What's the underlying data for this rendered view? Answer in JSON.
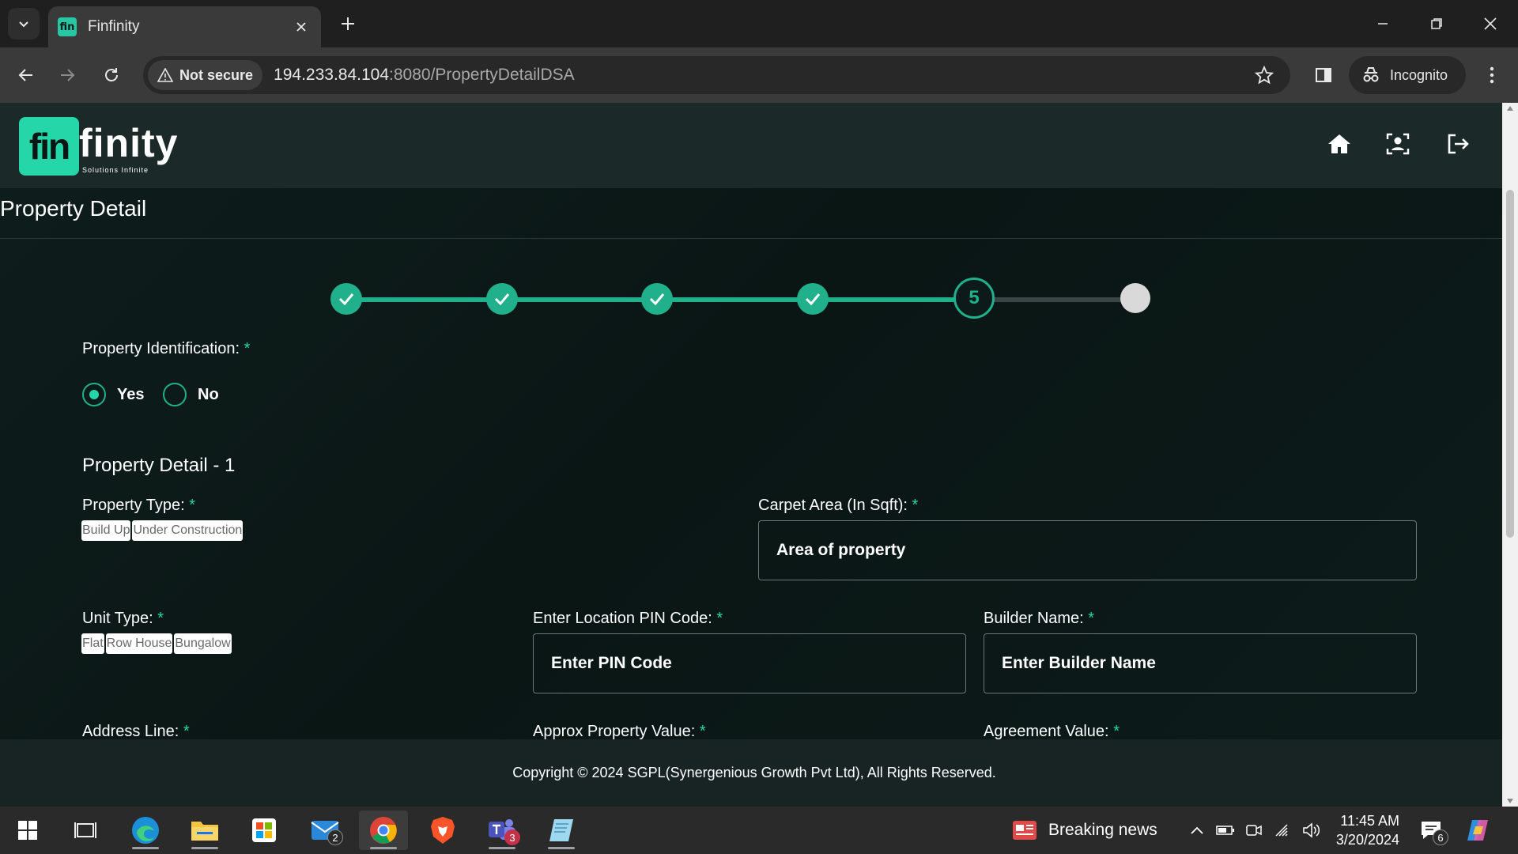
{
  "browser": {
    "tab_title": "Finfinity",
    "tab_favicon_text": "fin",
    "security_label": "Not secure",
    "url_host": "194.233.84.104",
    "url_path": ":8080/PropertyDetailDSA",
    "profile_label": "Incognito"
  },
  "header": {
    "logo_mark": "fin",
    "logo_text": "finity",
    "logo_tagline": "Solutions Infinite",
    "icons": [
      "home-icon",
      "profile-icon",
      "logout-icon"
    ]
  },
  "page": {
    "title": "Property Detail"
  },
  "stepper": {
    "total_steps": 6,
    "completed_steps": 4,
    "active_step_label": "5",
    "colors": {
      "done": "#21b08c",
      "pending": "#d9d9d9",
      "track": "#3a4645"
    }
  },
  "form": {
    "property_identification": {
      "label": "Property Identification:",
      "required_mark": "*",
      "options": [
        {
          "label": "Yes",
          "selected": true
        },
        {
          "label": "No",
          "selected": false
        }
      ]
    },
    "section_title": "Property Detail - 1",
    "property_type": {
      "label": "Property Type:",
      "required_mark": "*",
      "options": [
        "Build Up",
        "Under Construction"
      ]
    },
    "carpet_area": {
      "label": "Carpet Area (In Sqft):",
      "required_mark": "*",
      "placeholder": "Area of property"
    },
    "unit_type": {
      "label": "Unit Type:",
      "required_mark": "*",
      "options": [
        "Flat",
        "Row House",
        "Bungalow"
      ]
    },
    "pin_code": {
      "label": "Enter Location PIN Code:",
      "required_mark": "*",
      "placeholder": "Enter PIN Code"
    },
    "builder_name": {
      "label": "Builder Name:",
      "required_mark": "*",
      "placeholder": "Enter Builder Name"
    },
    "address_line": {
      "label": "Address Line:",
      "required_mark": "*"
    },
    "approx_value": {
      "label": "Approx Property Value:",
      "required_mark": "*"
    },
    "agreement_value": {
      "label": "Agreement Value:",
      "required_mark": "*"
    }
  },
  "footer": {
    "copyright": "Copyright © 2024 SGPL(Synergenious Growth Pvt Ltd), All Rights Reserved."
  },
  "taskbar": {
    "mail_badge": "2",
    "teams_badge": "3",
    "news_label": "Breaking news",
    "time": "11:45 AM",
    "date": "3/20/2024",
    "notification_count": "6"
  },
  "colors": {
    "accent": "#25d6a9",
    "page_bg": "#0c1b1a",
    "header_bg": "#1b2a29"
  }
}
